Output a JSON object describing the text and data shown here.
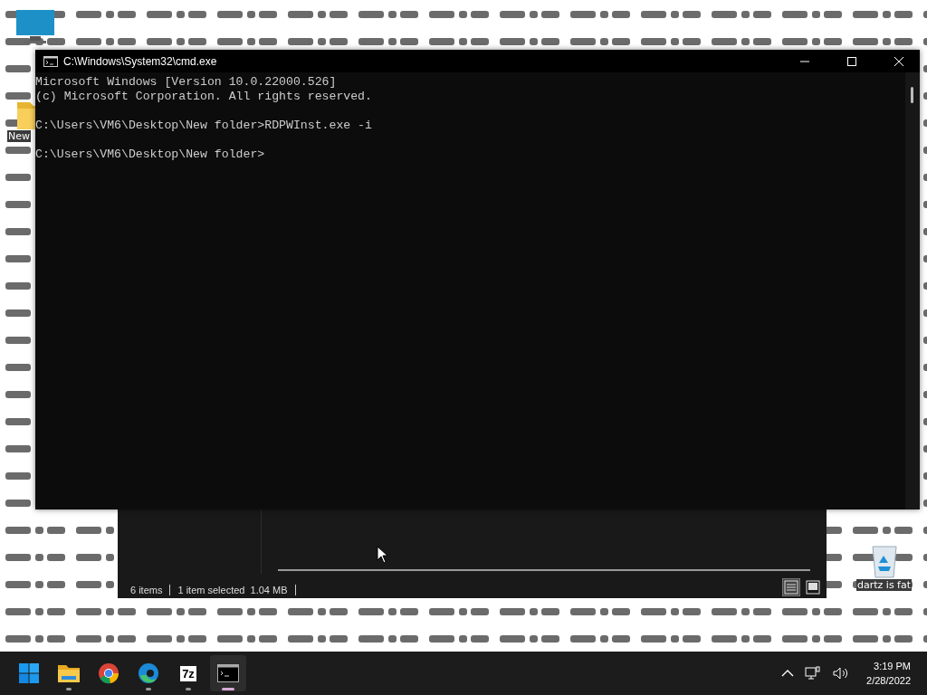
{
  "desktop_icons": [
    {
      "kind": "monitor"
    },
    {
      "kind": "folder",
      "label": "New"
    },
    {
      "kind": "recycle",
      "label": "dartz is fat"
    }
  ],
  "explorer": {
    "status": [
      "6 items",
      "1 item selected  1.04 MB"
    ],
    "views": [
      {
        "kind": "details",
        "selected": true
      },
      {
        "kind": "tiles",
        "selected": false
      }
    ]
  },
  "cmd": {
    "title": "C:\\Windows\\System32\\cmd.exe",
    "output": [
      [
        "Microsoft Windows [Version 10.0.22000.526]",
        "(c) Microsoft Corporation. All rights reserved."
      ],
      [
        "C:\\Users\\VM6\\Desktop\\New folder>RDPWInst.exe -i"
      ],
      [
        "C:\\Users\\VM6\\Desktop\\New folder>"
      ]
    ]
  },
  "taskbar": {
    "apps": [
      {
        "kind": "start",
        "running": false,
        "selected": false
      },
      {
        "kind": "explorer",
        "running": true,
        "selected": false
      },
      {
        "kind": "chrome",
        "running": false,
        "selected": false
      },
      {
        "kind": "edge",
        "running": true,
        "selected": false
      },
      {
        "kind": "sevenzip",
        "label": "7z",
        "running": true,
        "selected": false
      },
      {
        "kind": "terminal",
        "running": true,
        "selected": true
      }
    ],
    "time": "3:19 PM",
    "date": "2/28/2022"
  }
}
